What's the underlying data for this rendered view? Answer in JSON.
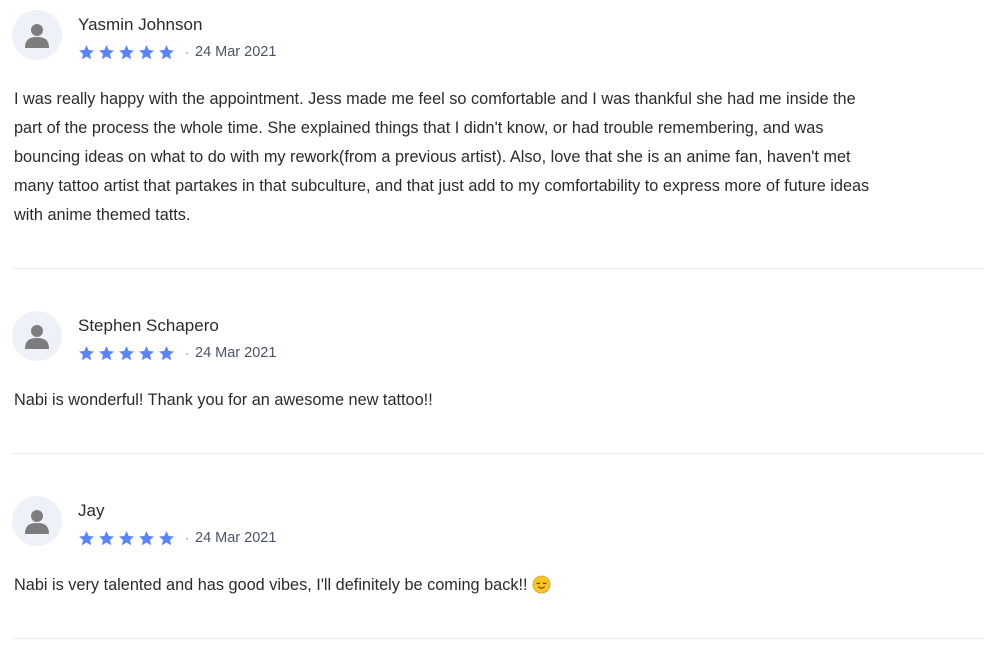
{
  "reviews": [
    {
      "name": "Yasmin Johnson",
      "rating": 5,
      "date": "24 Mar 2021",
      "text": "I was really happy with the appointment. Jess made me feel so comfortable and I was thankful she had me inside the part of the process the whole time. She explained things that I didn't know, or had trouble remembering, and was bouncing ideas on what to do with my rework(from a previous artist). Also, love that she is an anime fan, haven't met many tattoo artist that partakes in that subculture, and that just add to my comfortability to express more of future ideas with anime themed tatts."
    },
    {
      "name": "Stephen Schapero",
      "rating": 5,
      "date": "24 Mar 2021",
      "text": "Nabi is wonderful! Thank you for an awesome new tattoo!!"
    },
    {
      "name": "Jay",
      "rating": 5,
      "date": "24 Mar 2021",
      "text": "Nabi is very talented and has good vibes, I'll definitely be coming back!!",
      "emoji": "relieved-face-icon"
    }
  ],
  "separator": "·",
  "colors": {
    "star": "#5b84f5",
    "avatar_bg": "#eef1f8",
    "avatar_icon": "#7d7d7d",
    "divider": "#ececec",
    "text": "#2b2b2b",
    "date": "#4a5563"
  }
}
